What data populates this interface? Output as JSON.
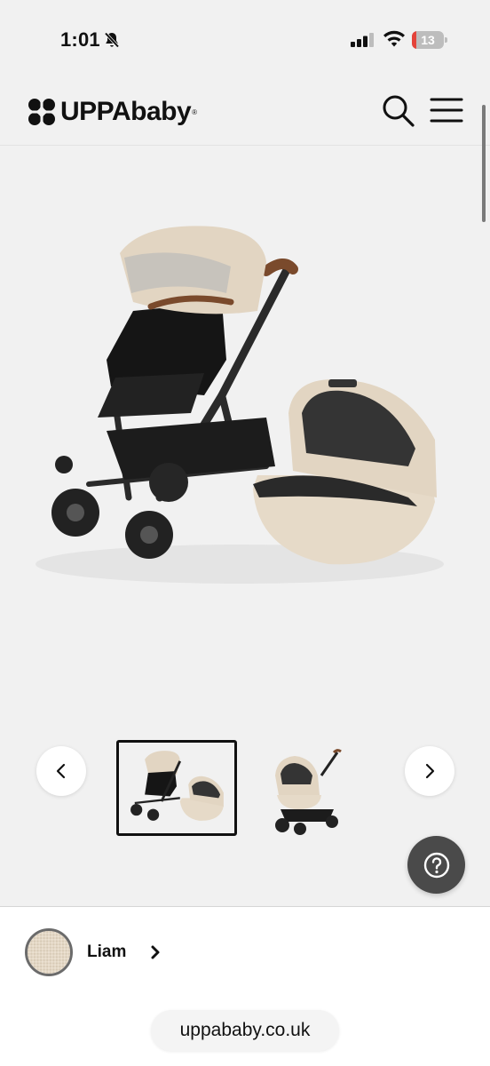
{
  "status_bar": {
    "time": "1:01",
    "battery_level": "13",
    "battery_fraction": 0.13,
    "battery_color": "#e4433a"
  },
  "header": {
    "logo_text": "UPPAbaby",
    "logo_tm": "®",
    "icons": [
      "search-icon",
      "hamburger-menu-icon"
    ]
  },
  "gallery": {
    "main_image": "stroller-with-bassinet",
    "thumbnails": [
      "stroller-with-bassinet",
      "bassinet-on-chassis"
    ],
    "selected_index": 0,
    "prev_icon": "chevron-left-icon",
    "next_icon": "chevron-right-icon"
  },
  "help": {
    "icon": "question-mark-icon"
  },
  "color_selector": {
    "name": "Liam",
    "swatch_color": "#e4d8c6"
  },
  "browser": {
    "url": "uppababy.co.uk"
  }
}
